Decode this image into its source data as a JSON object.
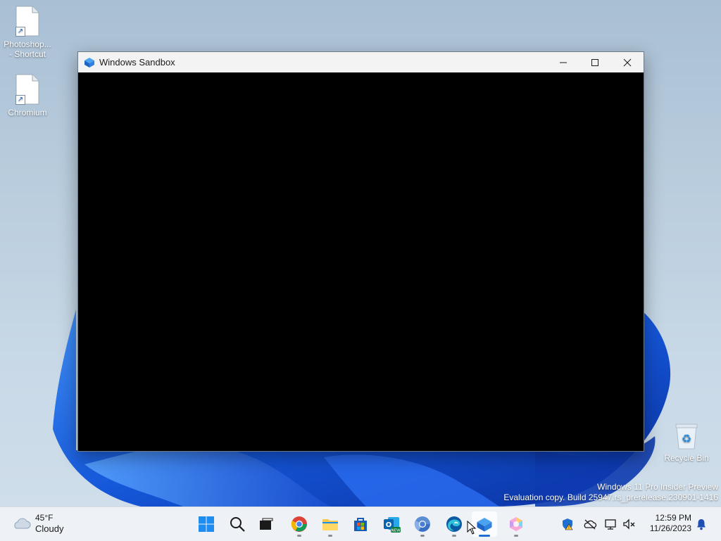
{
  "desktop": {
    "icons": [
      {
        "line1": "Photoshop...",
        "line2": "- Shortcut"
      },
      {
        "line1": "Chromium",
        "line2": ""
      },
      {
        "line1": "Recycle Bin",
        "line2": ""
      }
    ]
  },
  "window": {
    "title": "Windows Sandbox",
    "controls": {
      "minimize": "minimize",
      "maximize": "maximize",
      "close": "close"
    }
  },
  "watermark": {
    "line1": "Windows 11 Pro Insider Preview",
    "line2": "Evaluation copy. Build 25947.rs_prerelease.230901-1416"
  },
  "taskbar": {
    "weather": {
      "temp": "45°F",
      "condition": "Cloudy"
    },
    "apps": [
      {
        "name": "start-icon"
      },
      {
        "name": "search-icon"
      },
      {
        "name": "task-view-icon"
      },
      {
        "name": "chrome-icon"
      },
      {
        "name": "file-explorer-icon"
      },
      {
        "name": "microsoft-store-icon"
      },
      {
        "name": "outlook-new-icon"
      },
      {
        "name": "chromium-icon"
      },
      {
        "name": "edge-icon"
      },
      {
        "name": "windows-sandbox-icon"
      },
      {
        "name": "copilot-icon"
      }
    ],
    "clock": {
      "time": "12:59 PM",
      "date": "11/26/2023"
    }
  },
  "colors": {
    "accent": "#1f6fd1",
    "titlebar": "#f3f3f3",
    "taskbar": "#eef1f5"
  }
}
